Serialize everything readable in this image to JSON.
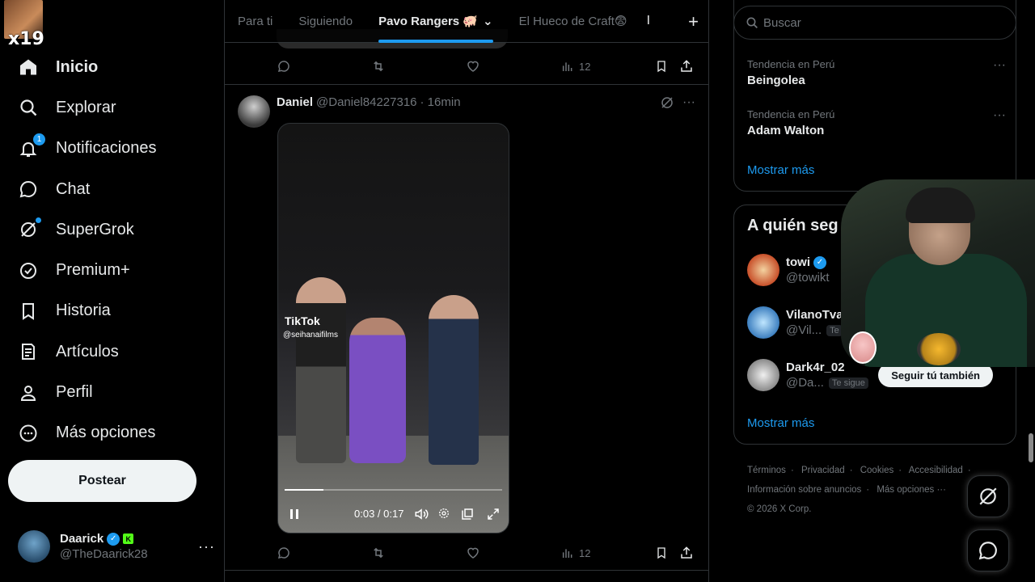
{
  "overlay": {
    "top_label": "x19"
  },
  "sidebar": {
    "items": [
      {
        "label": "Inicio",
        "icon": "home-icon",
        "active": true
      },
      {
        "label": "Explorar",
        "icon": "search-icon"
      },
      {
        "label": "Notificaciones",
        "icon": "bell-icon",
        "badge": "1"
      },
      {
        "label": "Chat",
        "icon": "chat-icon"
      },
      {
        "label": "SuperGrok",
        "icon": "grok-icon",
        "dot": true
      },
      {
        "label": "Premium+",
        "icon": "verified-icon"
      },
      {
        "label": "Historia",
        "icon": "bookmark-icon"
      },
      {
        "label": "Artículos",
        "icon": "articles-icon"
      },
      {
        "label": "Perfil",
        "icon": "person-icon"
      },
      {
        "label": "Más opciones",
        "icon": "more-circle-icon"
      }
    ],
    "post_label": "Postear",
    "account": {
      "name": "Daarick",
      "handle": "@TheDaarick28",
      "kick_badge": "K"
    }
  },
  "tabs": {
    "items": [
      "Para ti",
      "Siguiendo",
      "Pavo Rangers 🐖",
      "El Hueco de Craft😨",
      "I"
    ],
    "active_index": 2
  },
  "prev_post": {
    "views": "12"
  },
  "post": {
    "name": "Daniel",
    "handle": "@Daniel84227316",
    "time": "· 16min",
    "video": {
      "watermark": "TikTok",
      "watermark_user": "@seihanaifilms",
      "time": "0:03 / 0:17",
      "progress": 0.18
    },
    "views": "12"
  },
  "search": {
    "placeholder": "Buscar"
  },
  "trends": [
    {
      "context": "Tendencia en Perú",
      "title": "Beingolea"
    },
    {
      "context": "Tendencia en Perú",
      "title": "Adam Walton"
    }
  ],
  "trends_show_more": "Mostrar más",
  "who_to_follow": {
    "title": "A quién seg",
    "users": [
      {
        "name": "towi",
        "handle": "@towikt",
        "verified": true
      },
      {
        "name": "VilanoTva",
        "handle": "@Vil...",
        "follows_you": "Te"
      },
      {
        "name": "Dark4r_02",
        "handle": "@Da...",
        "follows_you": "Te sigue",
        "button": "Seguir tú también"
      }
    ],
    "show_more": "Mostrar más"
  },
  "footer": {
    "links": [
      "Términos",
      "Privacidad",
      "Cookies",
      "Accesibilidad",
      "Información sobre anuncios",
      "Más opciones ···"
    ],
    "copyright": "© 2026 X Corp."
  },
  "colors": {
    "accent": "#1d9bf0",
    "background": "#000000",
    "border": "#2f3336",
    "muted": "#71767b"
  }
}
